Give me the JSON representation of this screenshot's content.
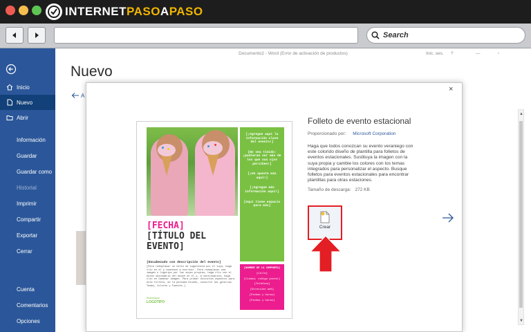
{
  "browser": {
    "logo": {
      "part1": "INTERNET",
      "part2": "PASO",
      "part3": "A",
      "part4": "PASO"
    },
    "search_placeholder": "Search"
  },
  "word": {
    "doc_title": "Documento2 - Word (Error de activación de productos)",
    "signin": "Inic. ses.",
    "help": "?",
    "page_heading": "Nuevo",
    "back_letter": "A",
    "sidebar": {
      "items": [
        {
          "label": "Inicio",
          "icon": "home-icon"
        },
        {
          "label": "Nuevo",
          "icon": "new-document-icon"
        },
        {
          "label": "Abrir",
          "icon": "folder-open-icon"
        },
        {
          "label": "Información"
        },
        {
          "label": "Guardar"
        },
        {
          "label": "Guardar como"
        },
        {
          "label": "Historial"
        },
        {
          "label": "Imprimir"
        },
        {
          "label": "Compartir"
        },
        {
          "label": "Exportar"
        },
        {
          "label": "Cerrar"
        },
        {
          "label": "Cuenta"
        },
        {
          "label": "Comentarios"
        },
        {
          "label": "Opciones"
        }
      ]
    }
  },
  "dialog": {
    "close": "×",
    "title": "Folleto de evento estacional",
    "provided_by_label": "Proporcionado por:",
    "provider": "Microsoft Corporation",
    "description": "Haga que todos conozcan su evento veraniego con este colorido diseño de plantilla para folletos de eventos estacionales. Sustituya la imagen con la suya propia y cambie los colores con los temas integrados para personalizar el aspecto. Busque folletos para eventos estacionales para encontrar plantillas para otras estaciones.",
    "download_label": "Tamaño de descarga:",
    "download_size": "272 KB",
    "create_label": "Crear",
    "flyer": {
      "fecha": "[FECHA]",
      "titulo": "[TÍTULO DEL EVENTO]",
      "subhead": "[Encabezado con descripción del evento]",
      "body": "[Para reemplazar un texto de sugerencia por el suyo, haga clic en él y comience a escribir. Para reemplazar una imagen o logotipo por las suyas propias, haga clic con el botón secundario del mouse en él y, a continuación, haga clic en Cambiar imagen. Para probar distintos aspectos para este folleto, en la pestaña Diseño, consulte las galerías Temas, Colores y Fuentes.]",
      "green_blocks": [
        "[¡Agregue aquí la información clave del evento!]",
        "[No sea tímido: ¡pudieran ser más de los que sus ojos perciben!]",
        "[¡Un apunte más aquí!]",
        "[¡Agregue más información aquí!]",
        "[Aquí tiene espacio para más]"
      ],
      "pink_blocks": [
        "[NOMBRE DE LA COMPAÑÍA]",
        "[Calle]",
        "[Ciudad, código postal]",
        "[Teléfono]",
        "[Dirección web]",
        "[Fechas y horas]",
        "[Fechas y horas]"
      ],
      "logo_small": "Reemplazar",
      "logo": "LOGOTIPO"
    }
  }
}
